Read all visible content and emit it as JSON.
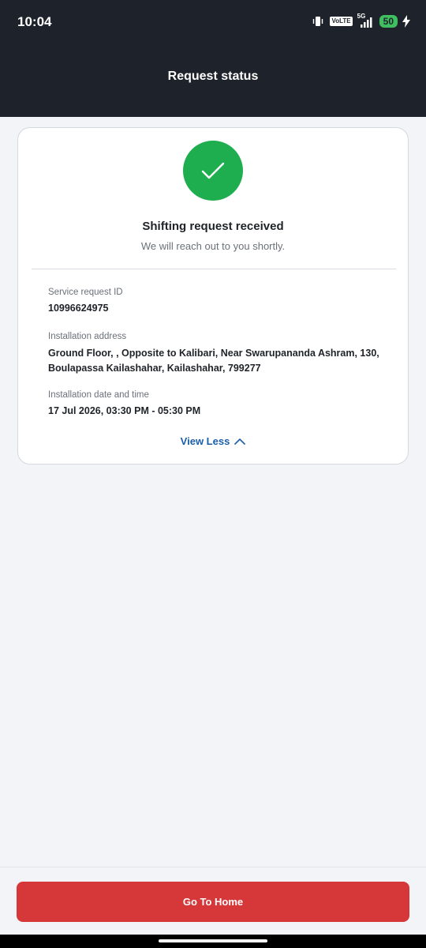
{
  "status_bar": {
    "time": "10:04",
    "volte": "VoLTE",
    "network": "5G",
    "battery": "50"
  },
  "header": {
    "title": "Request status"
  },
  "card": {
    "title": "Shifting request received",
    "subtitle": "We will reach out to you shortly.",
    "fields": [
      {
        "label": "Service request ID",
        "value": "10996624975"
      },
      {
        "label": "Installation address",
        "value": "Ground Floor, , Opposite to Kalibari, Near Swarupananda Ashram, 130, Boulapassa Kailashahar, Kailashahar, 799277"
      },
      {
        "label": "Installation date and time",
        "value": "17 Jul 2026, 03:30 PM - 05:30 PM"
      }
    ],
    "view_less_label": "View Less"
  },
  "footer": {
    "button_label": "Go To Home"
  },
  "colors": {
    "header_bg": "#1e232b",
    "success": "#1fae4f",
    "link": "#1a5fa8",
    "primary_button": "#d6383a"
  }
}
